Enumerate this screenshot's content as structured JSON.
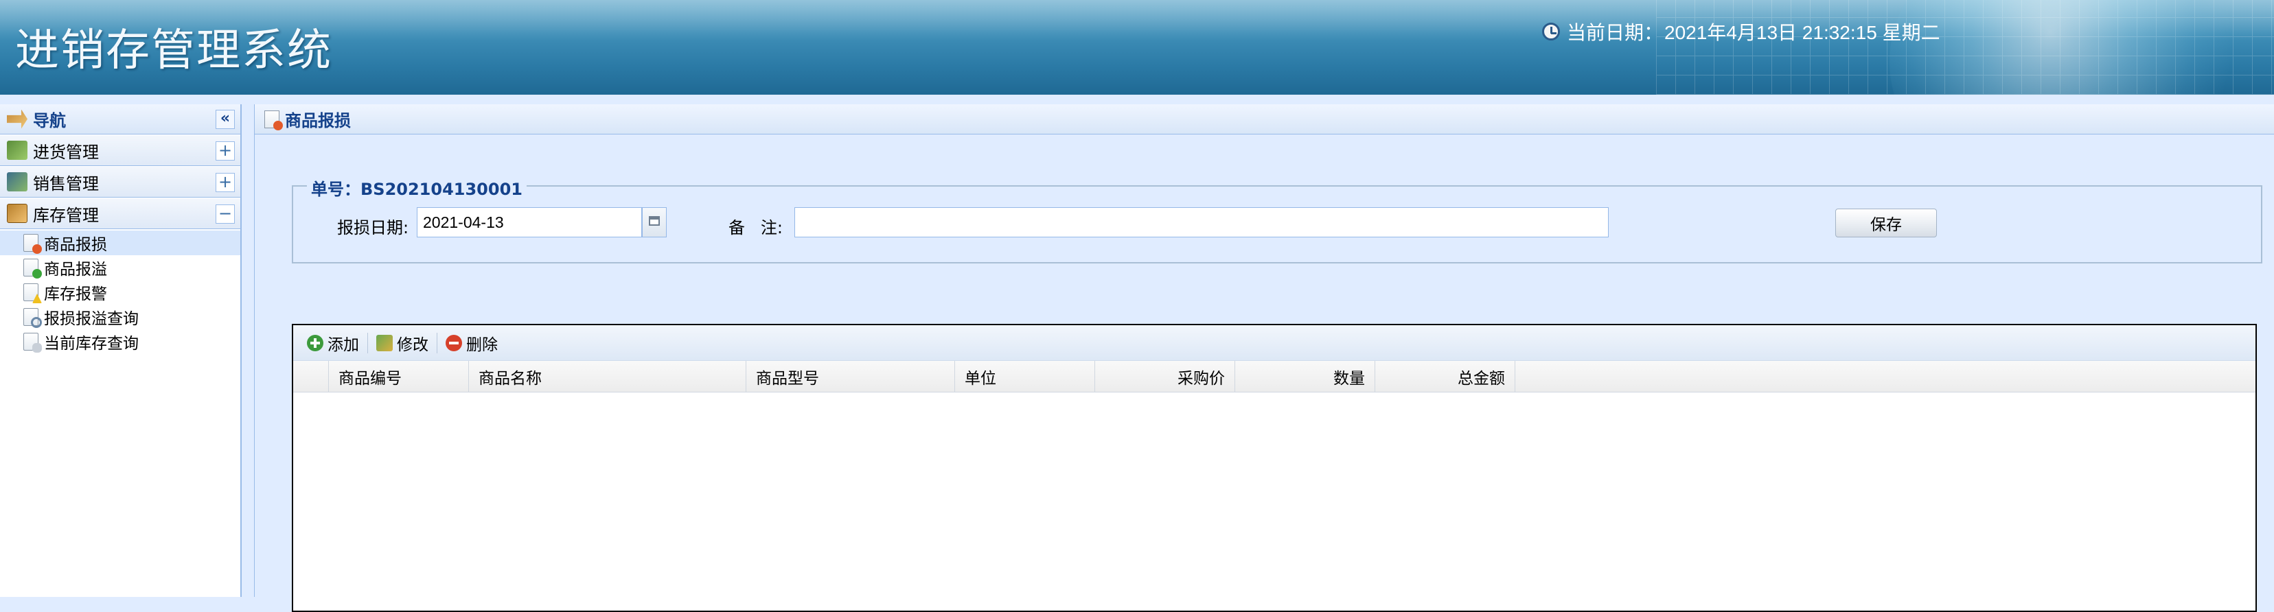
{
  "header": {
    "system_title": "进销存管理系统",
    "date_label": "当前日期：",
    "date_value": "2021年4月13日 21:32:15 星期二"
  },
  "sidebar": {
    "title": "导航",
    "collapse_symbol": "«",
    "groups": [
      {
        "label": "进货管理",
        "toggle": "+"
      },
      {
        "label": "销售管理",
        "toggle": "+"
      },
      {
        "label": "库存管理",
        "toggle": "−"
      }
    ],
    "items": [
      {
        "label": "商品报损",
        "icon": "loss-icon"
      },
      {
        "label": "商品报溢",
        "icon": "overflow-icon"
      },
      {
        "label": "库存报警",
        "icon": "alarm-icon"
      },
      {
        "label": "报损报溢查询",
        "icon": "search-doc-icon"
      },
      {
        "label": "当前库存查询",
        "icon": "database-icon"
      }
    ]
  },
  "main": {
    "tab_title": "商品报损",
    "form": {
      "order_label": "单号：",
      "order_no": "BS202104130001",
      "date_label": "报损日期:",
      "date_value": "2021-04-13",
      "remark_label": "备   注:",
      "remark_value": "",
      "save_label": "保存"
    },
    "toolbar": {
      "add": "添加",
      "edit": "修改",
      "delete": "删除"
    },
    "columns": [
      "商品编号",
      "商品名称",
      "商品型号",
      "单位",
      "采购价",
      "数量",
      "总金额"
    ],
    "rows": []
  },
  "colors": {
    "accent": "#15428b",
    "panel_border": "#99bbe8",
    "background": "#e0ecff"
  }
}
